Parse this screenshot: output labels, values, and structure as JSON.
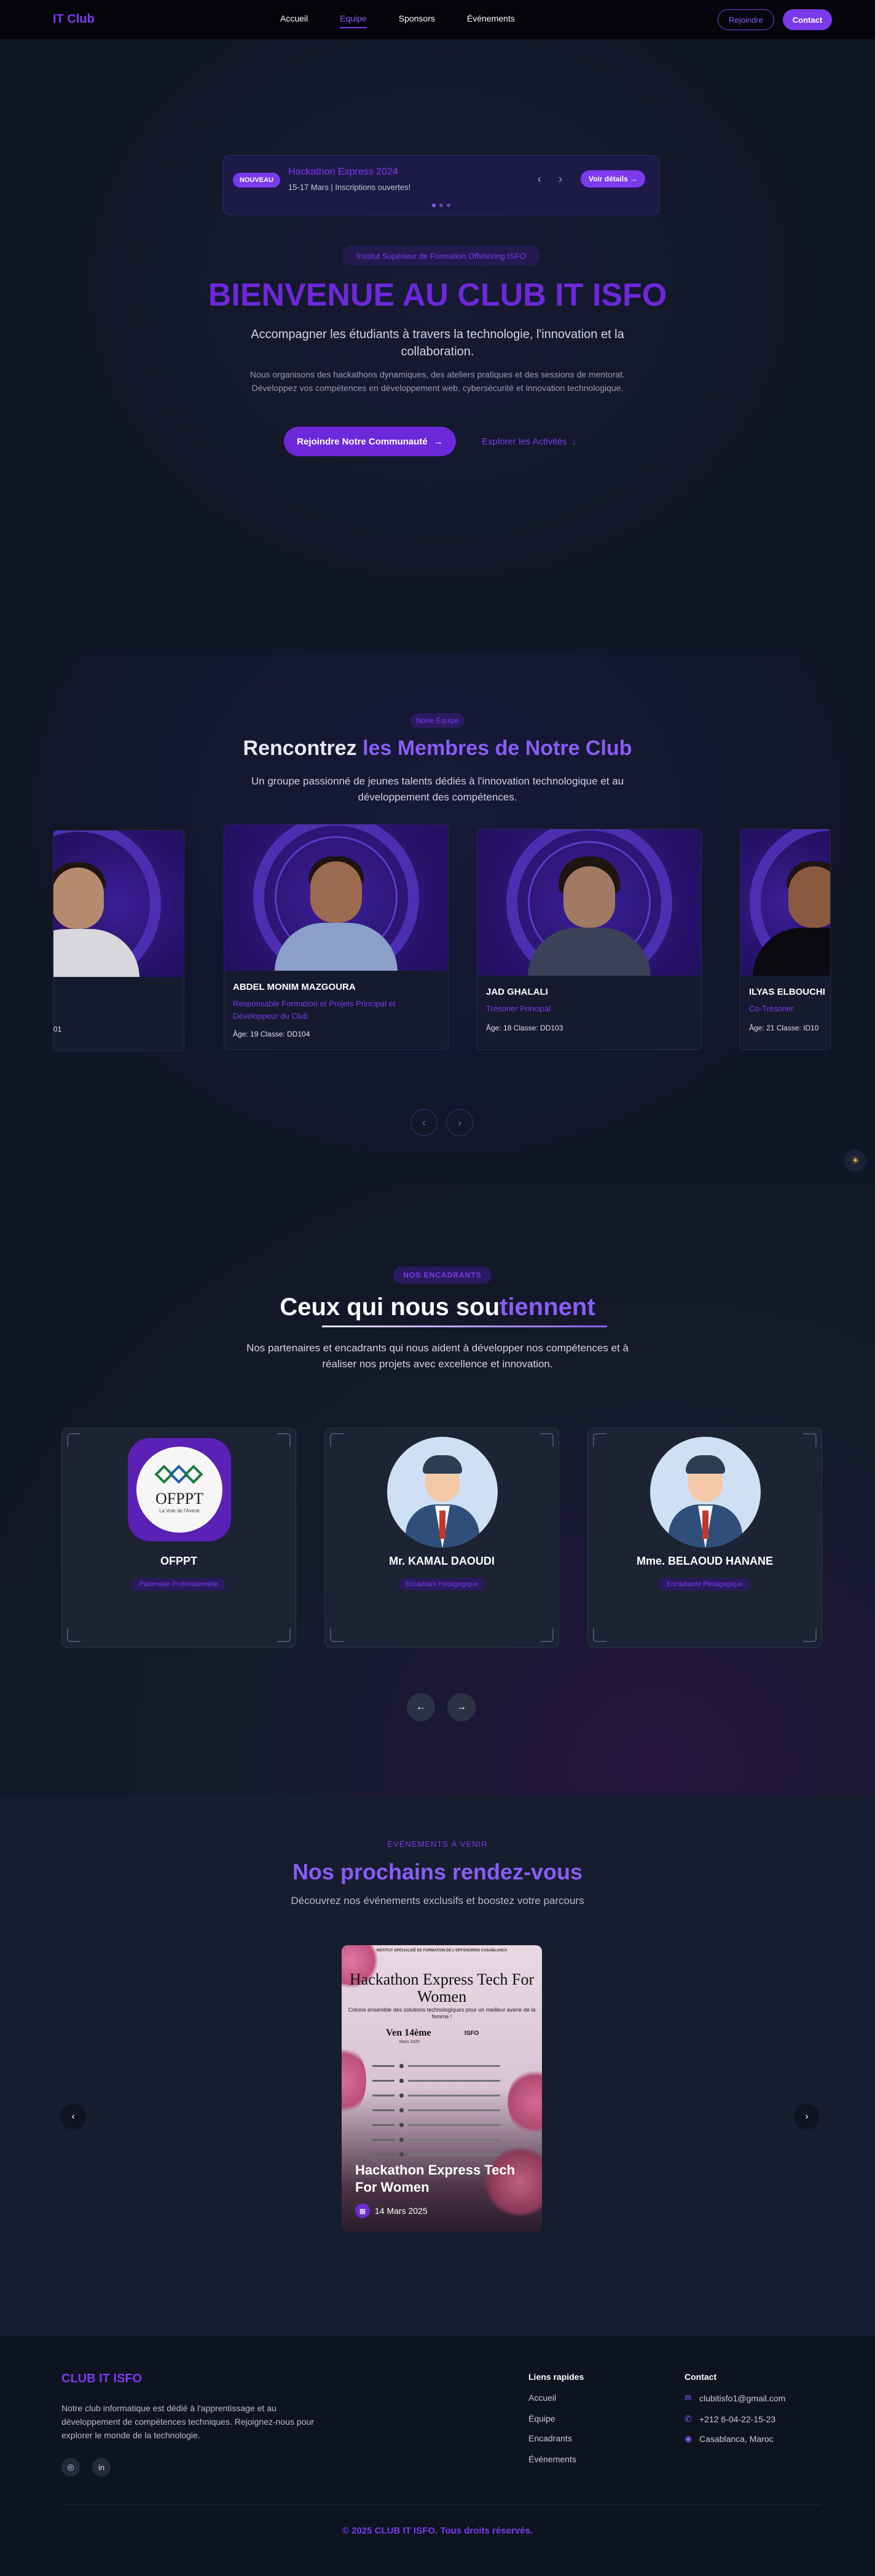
{
  "nav": {
    "logo": "IT Club",
    "links": [
      "Accueil",
      "Equipe",
      "Sponsors",
      "Événements"
    ],
    "active_index": 1,
    "join_label": "Rejoindre",
    "contact_label": "Contact"
  },
  "announcement": {
    "badge": "NOUVEAU",
    "title": "Hackathon Express 2024",
    "subtitle": "15-17 Mars | Inscriptions ouvertes!",
    "details_label": "Voir détails",
    "prev_icon": "chevron-left",
    "next_icon": "chevron-right"
  },
  "hero": {
    "tag": "Institut Supérieur de Formation Offshoring ISFO",
    "title": "BIENVENUE AU CLUB IT ISFO",
    "subtitle": "Accompagner les étudiants à travers la technologie, l'innovation et la collaboration.",
    "description": "Nous organisons des hackathons dynamiques, des ateliers pratiques et des sessions de mentorat. Développez vos compétences en développement web, cybersécurité et innovation technologique.",
    "cta_primary": "Rejoindre Notre Communauté",
    "cta_secondary": "Explorer les Activités"
  },
  "team": {
    "tag": "Notre Équipe",
    "title_start": "Rencontrez ",
    "title_accent": "les Membres de Notre Club",
    "subtitle": "Un groupe passionné de jeunes talents dédiés à l'innovation technologique et au développement des compétences.",
    "members": [
      {
        "name": "",
        "role": "",
        "meta": "01"
      },
      {
        "name": "ABDEL MONIM MAZGOURA",
        "role": "Responsable Formation et Projets Principal et Développeur du Club",
        "meta": "Âge: 19    Classe: DD104"
      },
      {
        "name": "JAD GHALALI",
        "role": "Trésorier Principal",
        "meta": "Âge: 18    Classe: DD103"
      },
      {
        "name": "ILYAS ELBOUCHI",
        "role": "Co-Trésorier",
        "meta": "Âge: 21    Classe: ID10"
      }
    ],
    "prev_label": "‹",
    "next_label": "›"
  },
  "sponsors": {
    "tag": "NOS ENCADRANTS",
    "title_start": "Ceux qui nous sou",
    "title_accent": "tiennent",
    "subtitle": "Nos partenaires et encadrants qui nous aident à développer nos compétences et à réaliser nos projets avec excellence et innovation.",
    "cards": [
      {
        "name": "OFPPT",
        "role": "Partenaire Professionnelle",
        "logo_text": "OFPPT",
        "logo_sub": "La Voie de l'Avenir"
      },
      {
        "name": "Mr. KAMAL DAOUDI",
        "role": "Encadrant Pédagogique",
        "logo_text": "",
        "logo_sub": ""
      },
      {
        "name": "Mme. BELAOUD HANANE",
        "role": "Encadrante Pédagogique",
        "logo_text": "",
        "logo_sub": ""
      }
    ],
    "prev_label": "←",
    "next_label": "→"
  },
  "events": {
    "kicker": "ÉVÉNEMENTS À VENIR",
    "title": "Nos prochains rendez-vous",
    "subtitle": "Découvrez nos événements exclusifs et boostez votre parcours",
    "poster": {
      "header": "INSTITUT SPÉCIALISÉ DE FORMATION DE L'OFFSHORING CASABLANCA",
      "title": "Hackathon Express Tech For Women",
      "tagline": "Créons ensemble des solutions technologiques pour un meilleur avenir de la femme !",
      "date": "Ven 14ème",
      "date_sub": "Mars 2025",
      "place": "ISFO"
    },
    "event_name": "Hackathon Express Tech For Women",
    "event_date": "14 Mars 2025",
    "prev_label": "‹",
    "next_label": "›"
  },
  "footer": {
    "logo": "CLUB IT ISFO",
    "description": "Notre club informatique est dédié à l'apprentissage et au développement de compétences techniques. Rejoignez-nous pour explorer le monde de la technologie.",
    "quick_links_title": "Liens rapides",
    "quick_links": [
      "Accueil",
      "Équipe",
      "Encadrants",
      "Événements"
    ],
    "contact_title": "Contact",
    "email": "clubitisfo1@gmail.com",
    "phone": "+212 6-04-22-15-23",
    "location": "Casablanca, Maroc",
    "copyright": "© 2025 CLUB IT ISFO. Tous droits réservés."
  },
  "colors": {
    "accent": "#7c3aed",
    "background": "#111626",
    "navbar": "#05060c"
  }
}
